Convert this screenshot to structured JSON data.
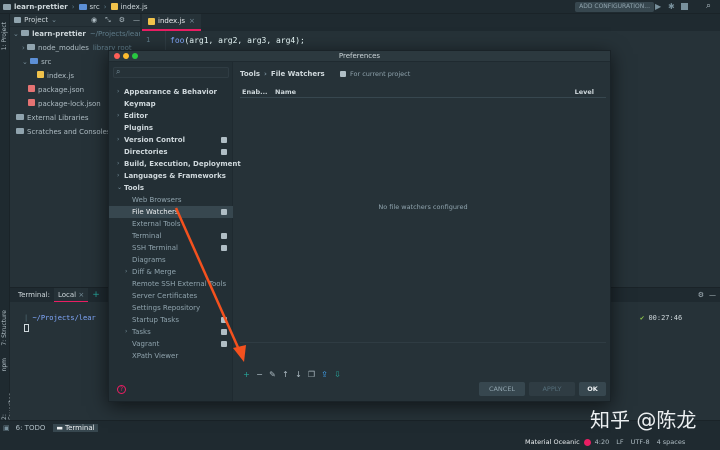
{
  "navbar": {
    "project": "learn-prettier",
    "folder": "src",
    "file": "index.js",
    "run_config": "ADD CONFIGURATION..."
  },
  "left_strip": {
    "project_tab": "1: Project",
    "structure_tab": "7: Structure",
    "npm_tab": "npm",
    "favorites_tab": "2: Favorites"
  },
  "project_panel": {
    "title": "Project",
    "root": "learn-prettier",
    "root_path": "~/Projects/learn-prett",
    "items": [
      "node_modules",
      "src",
      "index.js",
      "package.json",
      "package-lock.json",
      "External Libraries",
      "Scratches and Consoles"
    ],
    "node_modules_note": "library root"
  },
  "editor": {
    "tab": "index.js",
    "line_number": "1",
    "code_fn": "foo",
    "code_args": "(arg1, arg2, arg3, arg4);"
  },
  "terminal": {
    "label": "Terminal:",
    "tab": "Local",
    "prompt_path": "~/Projects/lear",
    "time": "00:27:46"
  },
  "statusbar": {
    "todo": "6: TODO",
    "terminal": "Terminal",
    "theme": "Material Oceanic",
    "position": "4:20",
    "line_sep": "LF",
    "encoding": "UTF-8",
    "indent": "4 spaces"
  },
  "dialog": {
    "title": "Preferences",
    "nav": [
      {
        "label": "Appearance & Behavior",
        "level": "top",
        "arrow": "›"
      },
      {
        "label": "Keymap",
        "level": "top"
      },
      {
        "label": "Editor",
        "level": "top",
        "arrow": "›"
      },
      {
        "label": "Plugins",
        "level": "top"
      },
      {
        "label": "Version Control",
        "level": "top",
        "arrow": "›",
        "profile": true
      },
      {
        "label": "Directories",
        "level": "top",
        "profile": true
      },
      {
        "label": "Build, Execution, Deployment",
        "level": "top",
        "arrow": "›"
      },
      {
        "label": "Languages & Frameworks",
        "level": "top",
        "arrow": "›"
      },
      {
        "label": "Tools",
        "level": "top",
        "arrow": "⌄"
      },
      {
        "label": "Web Browsers",
        "level": "sub"
      },
      {
        "label": "File Watchers",
        "level": "sub",
        "selected": true,
        "profile": true
      },
      {
        "label": "External Tools",
        "level": "sub"
      },
      {
        "label": "Terminal",
        "level": "sub",
        "profile": true
      },
      {
        "label": "SSH Terminal",
        "level": "sub",
        "profile": true
      },
      {
        "label": "Diagrams",
        "level": "sub"
      },
      {
        "label": "Diff & Merge",
        "level": "sub",
        "arrow": "›"
      },
      {
        "label": "Remote SSH External Tools",
        "level": "sub"
      },
      {
        "label": "Server Certificates",
        "level": "sub"
      },
      {
        "label": "Settings Repository",
        "level": "sub"
      },
      {
        "label": "Startup Tasks",
        "level": "sub",
        "profile": true
      },
      {
        "label": "Tasks",
        "level": "sub",
        "arrow": "›",
        "profile": true
      },
      {
        "label": "Vagrant",
        "level": "sub",
        "profile": true
      },
      {
        "label": "XPath Viewer",
        "level": "sub"
      }
    ],
    "breadcrumb": [
      "Tools",
      "File Watchers"
    ],
    "for_project": "For current project",
    "columns": [
      "Enab...",
      "Name",
      "Level"
    ],
    "empty_message": "No file watchers configured",
    "toolbar": [
      "+",
      "−",
      "✎",
      "↑",
      "↓",
      "❐",
      "⇪",
      "⇩"
    ],
    "buttons": {
      "cancel": "CANCEL",
      "apply": "APPLY",
      "ok": "OK"
    },
    "help": "?"
  },
  "watermark": "知乎 @陈龙",
  "colors": {
    "accent": "#e91e63",
    "arrow": "#f4511e",
    "bg": "#263238"
  }
}
